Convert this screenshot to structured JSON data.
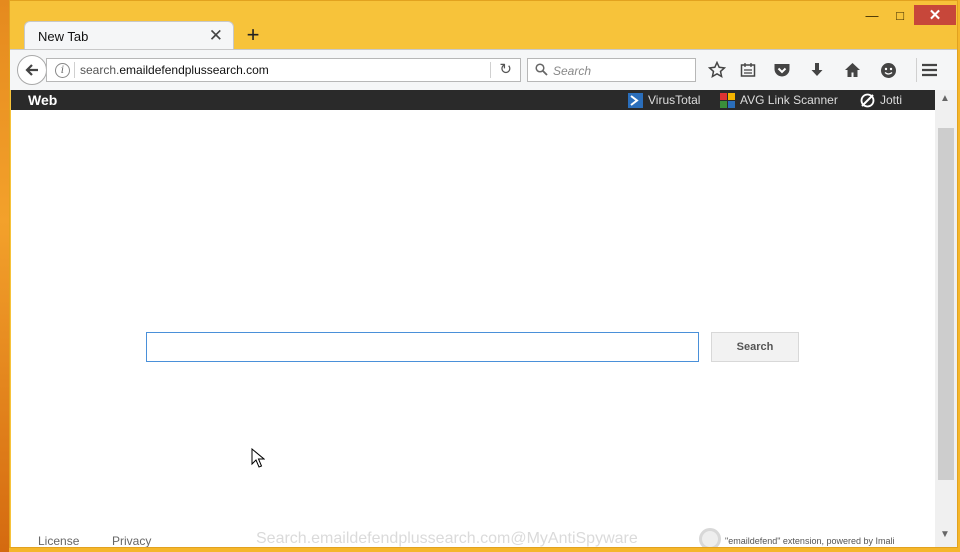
{
  "window": {
    "minimize": "—",
    "maximize": "□",
    "close": "✕"
  },
  "tab": {
    "title": "New Tab",
    "close": "✕",
    "new_tab": "+"
  },
  "address_bar": {
    "url_prefix": "search.",
    "url_domain": "emaildefendplussearch.com"
  },
  "search_bar": {
    "placeholder": "Search"
  },
  "toolbar_icons": [
    "bookmark-star-icon",
    "reading-list-icon",
    "pocket-icon",
    "download-icon",
    "home-icon",
    "smiley-icon",
    "menu-icon"
  ],
  "page": {
    "top_bar": {
      "web_label": "Web",
      "links": [
        {
          "label": "VirusTotal",
          "icon": "virustotal-icon"
        },
        {
          "label": "AVG Link Scanner",
          "icon": "avg-icon"
        },
        {
          "label": "Jotti",
          "icon": "jotti-icon"
        }
      ]
    },
    "search_input": {
      "value": ""
    },
    "search_button": "Search",
    "footer": {
      "license": "License",
      "privacy": "Privacy",
      "powered_by": "\"emaildefend\" extension, powered by Imali"
    },
    "watermark": "Search.emaildefendplussearch.com@MyAntiSpyware"
  },
  "colors": {
    "window_frame": "#f7c33a",
    "close_button": "#c7473a",
    "top_bar": "#2a2a2a",
    "input_border": "#4a90d9"
  }
}
